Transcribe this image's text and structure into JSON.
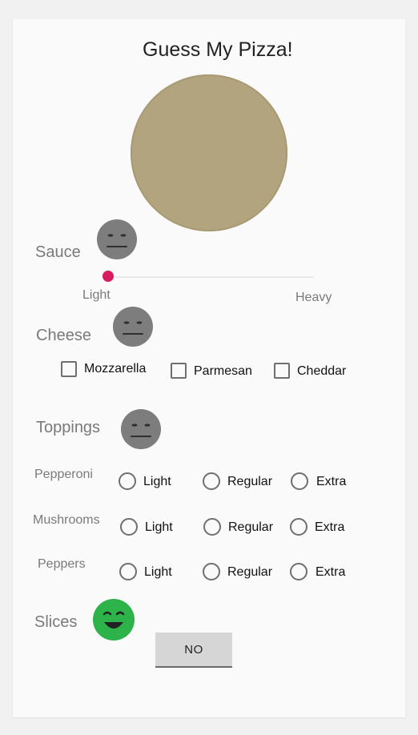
{
  "title": "Guess My Pizza!",
  "sauce": {
    "label": "Sauce",
    "slider_value": 0.0,
    "min_label": "Light",
    "max_label": "Heavy",
    "face_icon": "neutral-face-icon"
  },
  "cheese": {
    "label": "Cheese",
    "face_icon": "neutral-face-icon",
    "options": [
      {
        "label": "Mozzarella",
        "checked": false
      },
      {
        "label": "Parmesan",
        "checked": false
      },
      {
        "label": "Cheddar",
        "checked": false
      }
    ]
  },
  "toppings": {
    "label": "Toppings",
    "face_icon": "neutral-face-icon",
    "rows": [
      {
        "label": "Pepperoni",
        "options": [
          "Light",
          "Regular",
          "Extra"
        ]
      },
      {
        "label": "Mushrooms",
        "options": [
          "Light",
          "Regular",
          "Extra"
        ]
      },
      {
        "label": "Peppers",
        "options": [
          "Light",
          "Regular",
          "Extra"
        ]
      }
    ]
  },
  "slices": {
    "label": "Slices",
    "face_icon": "happy-face-icon"
  },
  "button": {
    "label": "NO"
  },
  "colors": {
    "pizza": "#b1a47f",
    "accent": "#d81b60",
    "neutral_face": "#7d7d7d",
    "happy_face": "#2db34a"
  }
}
